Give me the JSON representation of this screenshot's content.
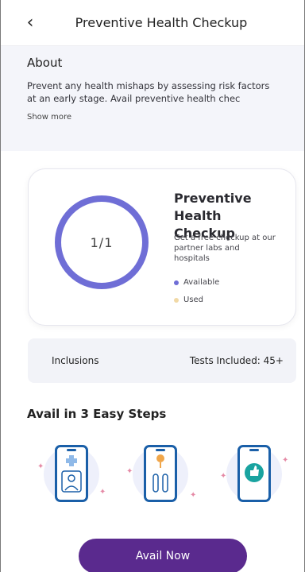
{
  "header": {
    "back_icon": "chevron-left-icon",
    "title": "Preventive Health Checkup"
  },
  "about": {
    "heading": "About",
    "text": "Prevent any health mishaps by assessing risk factors at an early stage. Avail preventive health chec",
    "show_more": "Show more"
  },
  "benefit_card": {
    "usage": "1/1",
    "usage_fraction": 1.0,
    "title": "Preventive Health Checkup",
    "description": "Get a free checkup at our partner labs and hospitals",
    "legend": [
      {
        "label": "Available",
        "color": "#6f6ed6"
      },
      {
        "label": "Used",
        "color": "#f1d9a6"
      }
    ]
  },
  "inclusions": {
    "label": "Inclusions",
    "tests": "Tests Included: 45+"
  },
  "steps": {
    "title": "Avail in 3 Easy Steps",
    "icons": [
      "doctor-phone-icon",
      "location-test-tubes-icon",
      "thumbs-up-badge-icon"
    ]
  },
  "cta": {
    "label": "Avail Now"
  },
  "colors": {
    "accent": "#6f6ed6",
    "cta": "#5a2a8e",
    "phone_outline": "#1a5fa8"
  }
}
